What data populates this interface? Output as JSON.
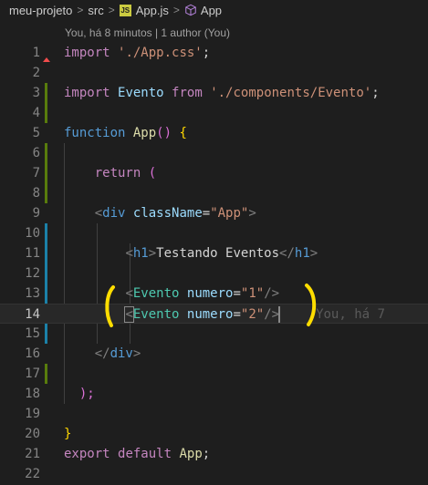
{
  "breadcrumb": {
    "project": "meu-projeto",
    "folder": "src",
    "file": "App.js",
    "file_badge": "JS",
    "symbol": "App",
    "separator": ">"
  },
  "blame_header": "You, há 8 minutos | 1 author (You)",
  "inline_blame": "You, há 7",
  "lines": [
    {
      "n": "1"
    },
    {
      "n": "2"
    },
    {
      "n": "3"
    },
    {
      "n": "4"
    },
    {
      "n": "5"
    },
    {
      "n": "6"
    },
    {
      "n": "7"
    },
    {
      "n": "8"
    },
    {
      "n": "9"
    },
    {
      "n": "10"
    },
    {
      "n": "11"
    },
    {
      "n": "12"
    },
    {
      "n": "13"
    },
    {
      "n": "14"
    },
    {
      "n": "15"
    },
    {
      "n": "16"
    },
    {
      "n": "17"
    },
    {
      "n": "18"
    },
    {
      "n": "19"
    },
    {
      "n": "20"
    },
    {
      "n": "21"
    },
    {
      "n": "22"
    }
  ],
  "tokens": {
    "l1": [
      "import",
      "'./App.css'",
      ";"
    ],
    "l3": [
      "import",
      "Evento",
      "from",
      "'./components/Evento'",
      ";"
    ],
    "l5": [
      "function",
      "App",
      "()",
      "{"
    ],
    "l7": [
      "return",
      "("
    ],
    "l9": [
      "<",
      "div",
      "className",
      "=",
      "\"App\"",
      ">"
    ],
    "l11": [
      "<",
      "h1",
      ">",
      "Testando Eventos",
      "</",
      "h1",
      ">"
    ],
    "l13": [
      "<",
      "Evento",
      "numero",
      "=",
      "\"1\"",
      "/>"
    ],
    "l14": [
      "<",
      "Evento",
      "numero",
      "=",
      "\"2\"",
      "/>"
    ],
    "l16": [
      "</",
      "div",
      ">"
    ],
    "l18": [
      ");"
    ],
    "l20": [
      "}"
    ],
    "l21": [
      "export",
      "default",
      "App",
      ";"
    ]
  },
  "colors": {
    "background": "#1e1e1e",
    "added_gutter": "#587c0c",
    "modified_gutter": "#1b81a8",
    "annotation_yellow": "#ffdd00"
  }
}
